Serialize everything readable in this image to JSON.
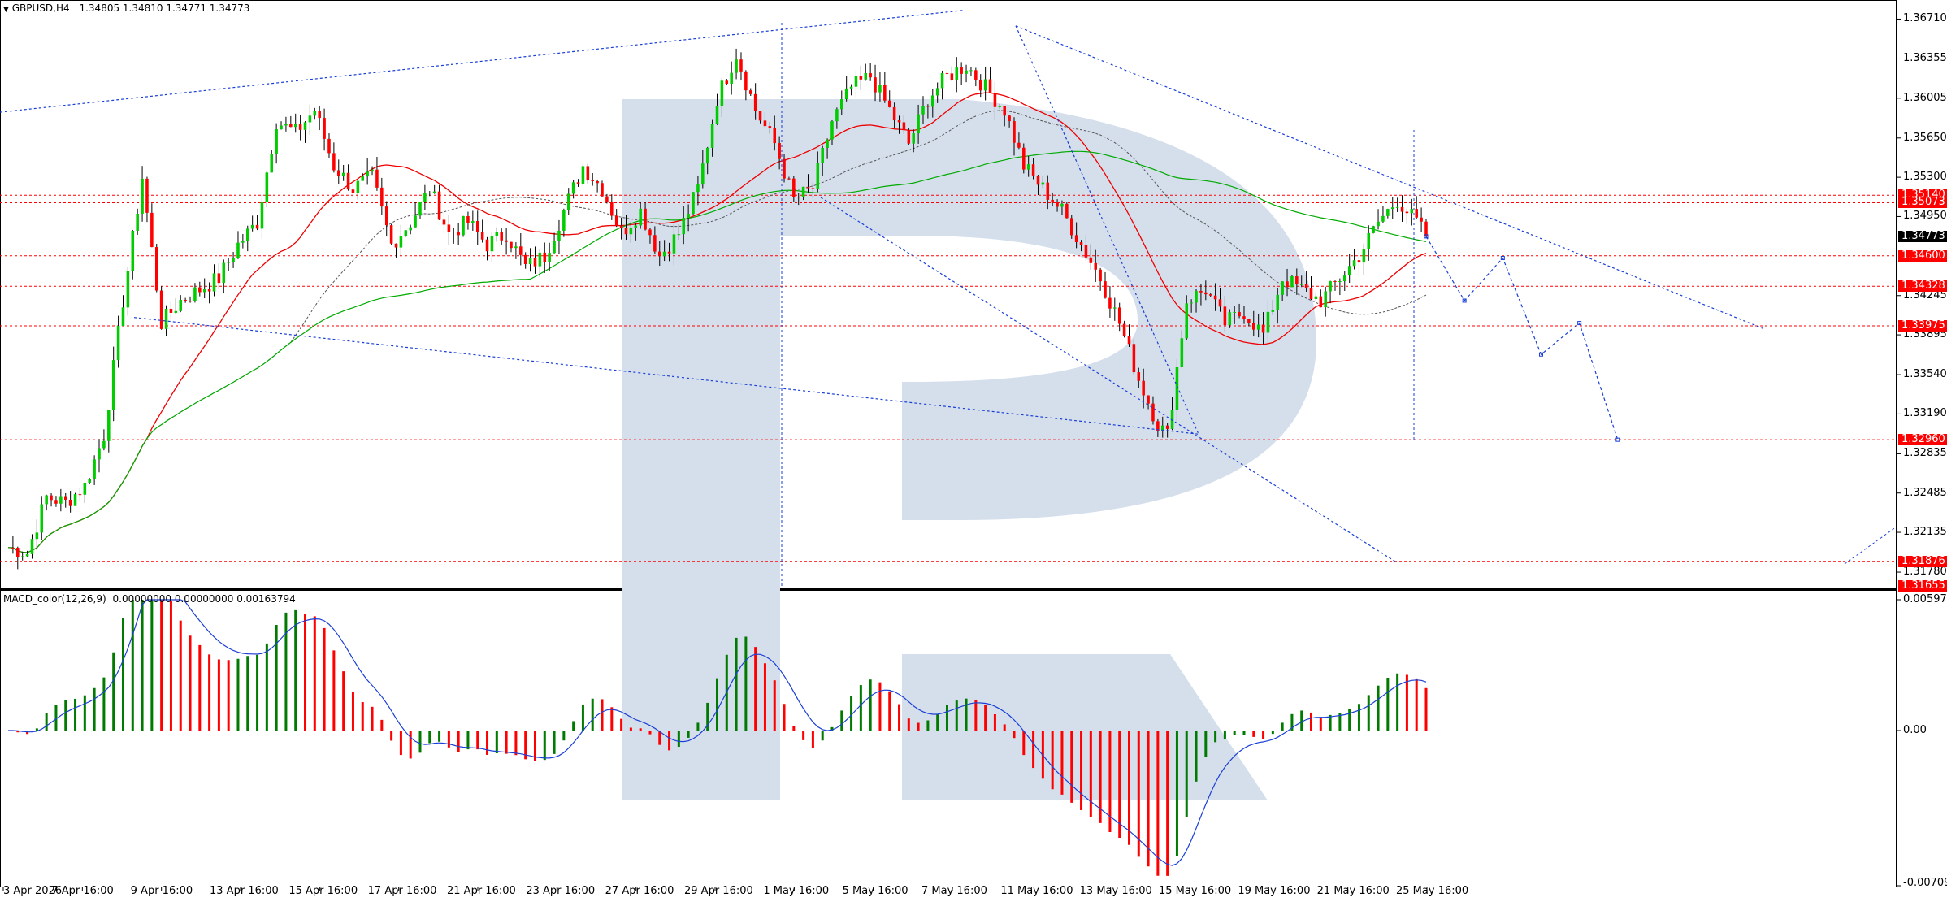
{
  "header": {
    "symbol": "GBPUSD,H4",
    "ohlc": "1.34805 1.34810 1.34771 1.34773"
  },
  "macd_header": {
    "title": "MACD_color(12,26,9)",
    "values": "0.00000000 0.00000000 0.00163794"
  },
  "colors": {
    "bull": "#00cc00",
    "bear": "#ff0000",
    "ma_fast": "#ee0000",
    "ma_slow": "#00aa00",
    "ma_mid": "#555555",
    "trend": "#1a3fd6",
    "level": "#ff0000",
    "macd_pos": "#007a00",
    "macd_neg": "#ff0000",
    "signal": "#1a3fd6",
    "watermark": "#d5dfec"
  },
  "chart_data": [
    {
      "type": "candlestick",
      "title": "GBPUSD,H4",
      "ylim": [
        1.3165,
        1.3688
      ],
      "price_axis_ticks": [
        "1.36710",
        "1.36355",
        "1.36005",
        "1.35650",
        "1.35300",
        "1.34950",
        "1.34245",
        "1.33895",
        "1.33540",
        "1.33190",
        "1.32835",
        "1.32485",
        "1.32135",
        "1.31780"
      ],
      "price_badges": [
        {
          "label": "1.35140",
          "value": 1.3514,
          "style": "red"
        },
        {
          "label": "1.35073",
          "value": 1.35073,
          "style": "red"
        },
        {
          "label": "1.34773",
          "value": 1.34773,
          "style": "black"
        },
        {
          "label": "1.34600",
          "value": 1.346,
          "style": "red"
        },
        {
          "label": "1.34328",
          "value": 1.34328,
          "style": "red"
        },
        {
          "label": "1.33975",
          "value": 1.33975,
          "style": "red"
        },
        {
          "label": "1.32960",
          "value": 1.3296,
          "style": "red"
        },
        {
          "label": "1.31876",
          "value": 1.31876,
          "style": "red"
        },
        {
          "label": "1.31655",
          "value": 1.31655,
          "style": "red"
        }
      ],
      "horizontal_levels": [
        1.3514,
        1.35073,
        1.346,
        1.34328,
        1.33975,
        1.3296,
        1.31876
      ],
      "x_labels": [
        "3 Apr 2026",
        "7 Apr 16:00",
        "9 Apr 16:00",
        "13 Apr 16:00",
        "15 Apr 16:00",
        "17 Apr 16:00",
        "21 Apr 16:00",
        "23 Apr 16:00",
        "27 Apr 16:00",
        "29 Apr 16:00",
        "1 May 16:00",
        "5 May 16:00",
        "7 May 16:00",
        "11 May 16:00",
        "13 May 16:00",
        "15 May 16:00",
        "19 May 16:00",
        "21 May 16:00",
        "25 May 16:00"
      ],
      "close_path": [
        [
          0,
          1.32
        ],
        [
          4,
          1.3195
        ],
        [
          8,
          1.3245
        ],
        [
          12,
          1.324
        ],
        [
          16,
          1.3255
        ],
        [
          20,
          1.33
        ],
        [
          24,
          1.342
        ],
        [
          28,
          1.353
        ],
        [
          32,
          1.34
        ],
        [
          36,
          1.342
        ],
        [
          40,
          1.343
        ],
        [
          44,
          1.344
        ],
        [
          48,
          1.347
        ],
        [
          52,
          1.349
        ],
        [
          56,
          1.358
        ],
        [
          60,
          1.357
        ],
        [
          64,
          1.359
        ],
        [
          68,
          1.354
        ],
        [
          72,
          1.352
        ],
        [
          76,
          1.353
        ],
        [
          80,
          1.347
        ],
        [
          84,
          1.349
        ],
        [
          88,
          1.352
        ],
        [
          92,
          1.348
        ],
        [
          96,
          1.349
        ],
        [
          100,
          1.347
        ],
        [
          104,
          1.348
        ],
        [
          108,
          1.345
        ],
        [
          112,
          1.346
        ],
        [
          116,
          1.35
        ],
        [
          120,
          1.354
        ],
        [
          124,
          1.352
        ],
        [
          128,
          1.348
        ],
        [
          132,
          1.35
        ],
        [
          136,
          1.346
        ],
        [
          140,
          1.348
        ],
        [
          144,
          1.352
        ],
        [
          148,
          1.36
        ],
        [
          152,
          1.364
        ],
        [
          156,
          1.359
        ],
        [
          160,
          1.356
        ],
        [
          164,
          1.351
        ],
        [
          168,
          1.352
        ],
        [
          172,
          1.358
        ],
        [
          176,
          1.361
        ],
        [
          180,
          1.362
        ],
        [
          184,
          1.359
        ],
        [
          188,
          1.356
        ],
        [
          192,
          1.36
        ],
        [
          196,
          1.362
        ],
        [
          200,
          1.363
        ],
        [
          204,
          1.361
        ],
        [
          208,
          1.359
        ],
        [
          212,
          1.354
        ],
        [
          216,
          1.352
        ],
        [
          220,
          1.35
        ],
        [
          224,
          1.347
        ],
        [
          228,
          1.344
        ],
        [
          232,
          1.34
        ],
        [
          236,
          1.335
        ],
        [
          240,
          1.331
        ],
        [
          242,
          1.33
        ],
        [
          246,
          1.342
        ],
        [
          250,
          1.343
        ],
        [
          254,
          1.34
        ],
        [
          258,
          1.341
        ],
        [
          262,
          1.339
        ],
        [
          266,
          1.344
        ],
        [
          270,
          1.343
        ],
        [
          274,
          1.342
        ],
        [
          278,
          1.344
        ],
        [
          282,
          1.346
        ],
        [
          286,
          1.349
        ],
        [
          290,
          1.351
        ],
        [
          294,
          1.349
        ],
        [
          296,
          1.34773
        ]
      ],
      "forecast_path": [
        [
          296,
          1.34773
        ],
        [
          304,
          1.342
        ],
        [
          312,
          1.3458
        ],
        [
          320,
          1.3372
        ],
        [
          328,
          1.34
        ],
        [
          336,
          1.3296
        ]
      ],
      "total_bars": 296
    },
    {
      "type": "bar",
      "title": "MACD_color(12,26,9)",
      "axis_ticks": [
        "0.0059755",
        "0.00",
        "-0.0070902"
      ],
      "ylim": [
        -0.0070902,
        0.0059755
      ]
    }
  ]
}
